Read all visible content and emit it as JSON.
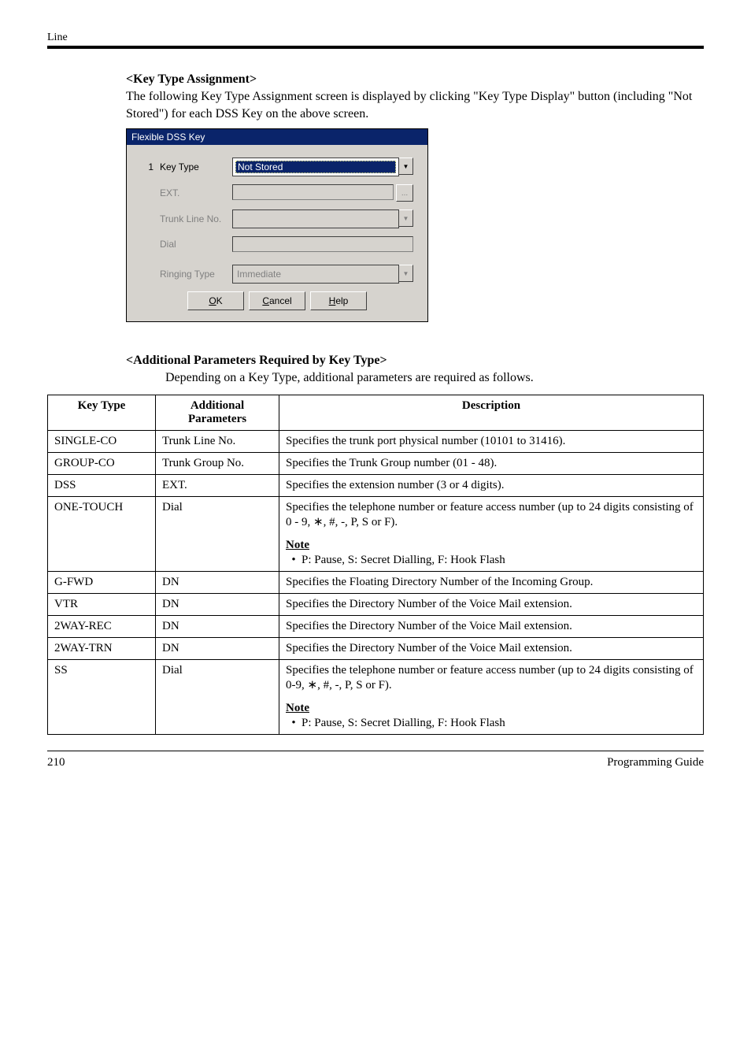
{
  "header_label": "Line",
  "section1": {
    "title": "<Key Type Assignment>",
    "intro": "The following Key Type Assignment screen is displayed by clicking \"Key Type Display\" button (including \"Not Stored\") for each DSS Key on the above screen."
  },
  "dialog": {
    "title": "Flexible DSS Key",
    "row_num": "1",
    "labels": {
      "key_type": "Key Type",
      "ext": "EXT.",
      "trunk": "Trunk Line No.",
      "dial": "Dial",
      "ringing": "Ringing Type"
    },
    "values": {
      "key_type": "Not Stored",
      "ringing": "Immediate"
    },
    "buttons": {
      "ok": "OK",
      "cancel": "Cancel",
      "help": "Help",
      "ok_ul": "O",
      "cancel_ul": "C",
      "help_ul": "H"
    },
    "dots": "..."
  },
  "section2": {
    "title": "<Additional Parameters Required by Key Type>",
    "intro": "Depending on a Key Type, additional parameters are required as follows."
  },
  "table": {
    "headers": {
      "c1": "Key Type",
      "c2": "Additional Parameters",
      "c3": "Description"
    },
    "rows": [
      {
        "kt": "SINGLE-CO",
        "ap": "Trunk Line No.",
        "desc": "Specifies the trunk port physical number (10101 to 31416)."
      },
      {
        "kt": "GROUP-CO",
        "ap": "Trunk Group No.",
        "desc": "Specifies the Trunk Group number (01 - 48)."
      },
      {
        "kt": "DSS",
        "ap": "EXT.",
        "desc": "Specifies the extension number (3 or 4 digits)."
      },
      {
        "kt": "ONE-TOUCH",
        "ap": "Dial",
        "desc": "Specifies the telephone number or feature access number (up to 24 digits consisting of 0 - 9, ∗, #, -, P, S or F).",
        "note_label": "Note",
        "note_text": "P: Pause, S: Secret Dialling, F: Hook Flash"
      },
      {
        "kt": "G-FWD",
        "ap": "DN",
        "desc": "Specifies the Floating Directory Number of the Incoming Group."
      },
      {
        "kt": "VTR",
        "ap": "DN",
        "desc": "Specifies the Directory Number of the Voice Mail extension."
      },
      {
        "kt": "2WAY-REC",
        "ap": "DN",
        "desc": "Specifies the Directory Number of the Voice Mail extension."
      },
      {
        "kt": "2WAY-TRN",
        "ap": "DN",
        "desc": "Specifies the Directory Number of the Voice Mail extension."
      },
      {
        "kt": "SS",
        "ap": "Dial",
        "desc": "Specifies the telephone number or feature access number (up to 24 digits consisting of 0-9, ∗, #, -, P, S or F).",
        "note_label": "Note",
        "note_text": "P: Pause, S: Secret Dialling, F: Hook Flash"
      }
    ]
  },
  "footer": {
    "page": "210",
    "doc": "Programming Guide"
  },
  "chart_data": {
    "type": "table",
    "title": "Additional Parameters Required by Key Type",
    "columns": [
      "Key Type",
      "Additional Parameters",
      "Description"
    ],
    "rows": [
      [
        "SINGLE-CO",
        "Trunk Line No.",
        "Specifies the trunk port physical number (10101 to 31416)."
      ],
      [
        "GROUP-CO",
        "Trunk Group No.",
        "Specifies the Trunk Group number (01 - 48)."
      ],
      [
        "DSS",
        "EXT.",
        "Specifies the extension number (3 or 4 digits)."
      ],
      [
        "ONE-TOUCH",
        "Dial",
        "Specifies the telephone number or feature access number (up to 24 digits consisting of 0 - 9, *, #, -, P, S or F). Note: P: Pause, S: Secret Dialling, F: Hook Flash"
      ],
      [
        "G-FWD",
        "DN",
        "Specifies the Floating Directory Number of the Incoming Group."
      ],
      [
        "VTR",
        "DN",
        "Specifies the Directory Number of the Voice Mail extension."
      ],
      [
        "2WAY-REC",
        "DN",
        "Specifies the Directory Number of the Voice Mail extension."
      ],
      [
        "2WAY-TRN",
        "DN",
        "Specifies the Directory Number of the Voice Mail extension."
      ],
      [
        "SS",
        "Dial",
        "Specifies the telephone number or feature access number (up to 24 digits consisting of 0-9, *, #, -, P, S or F). Note: P: Pause, S: Secret Dialling, F: Hook Flash"
      ]
    ]
  }
}
